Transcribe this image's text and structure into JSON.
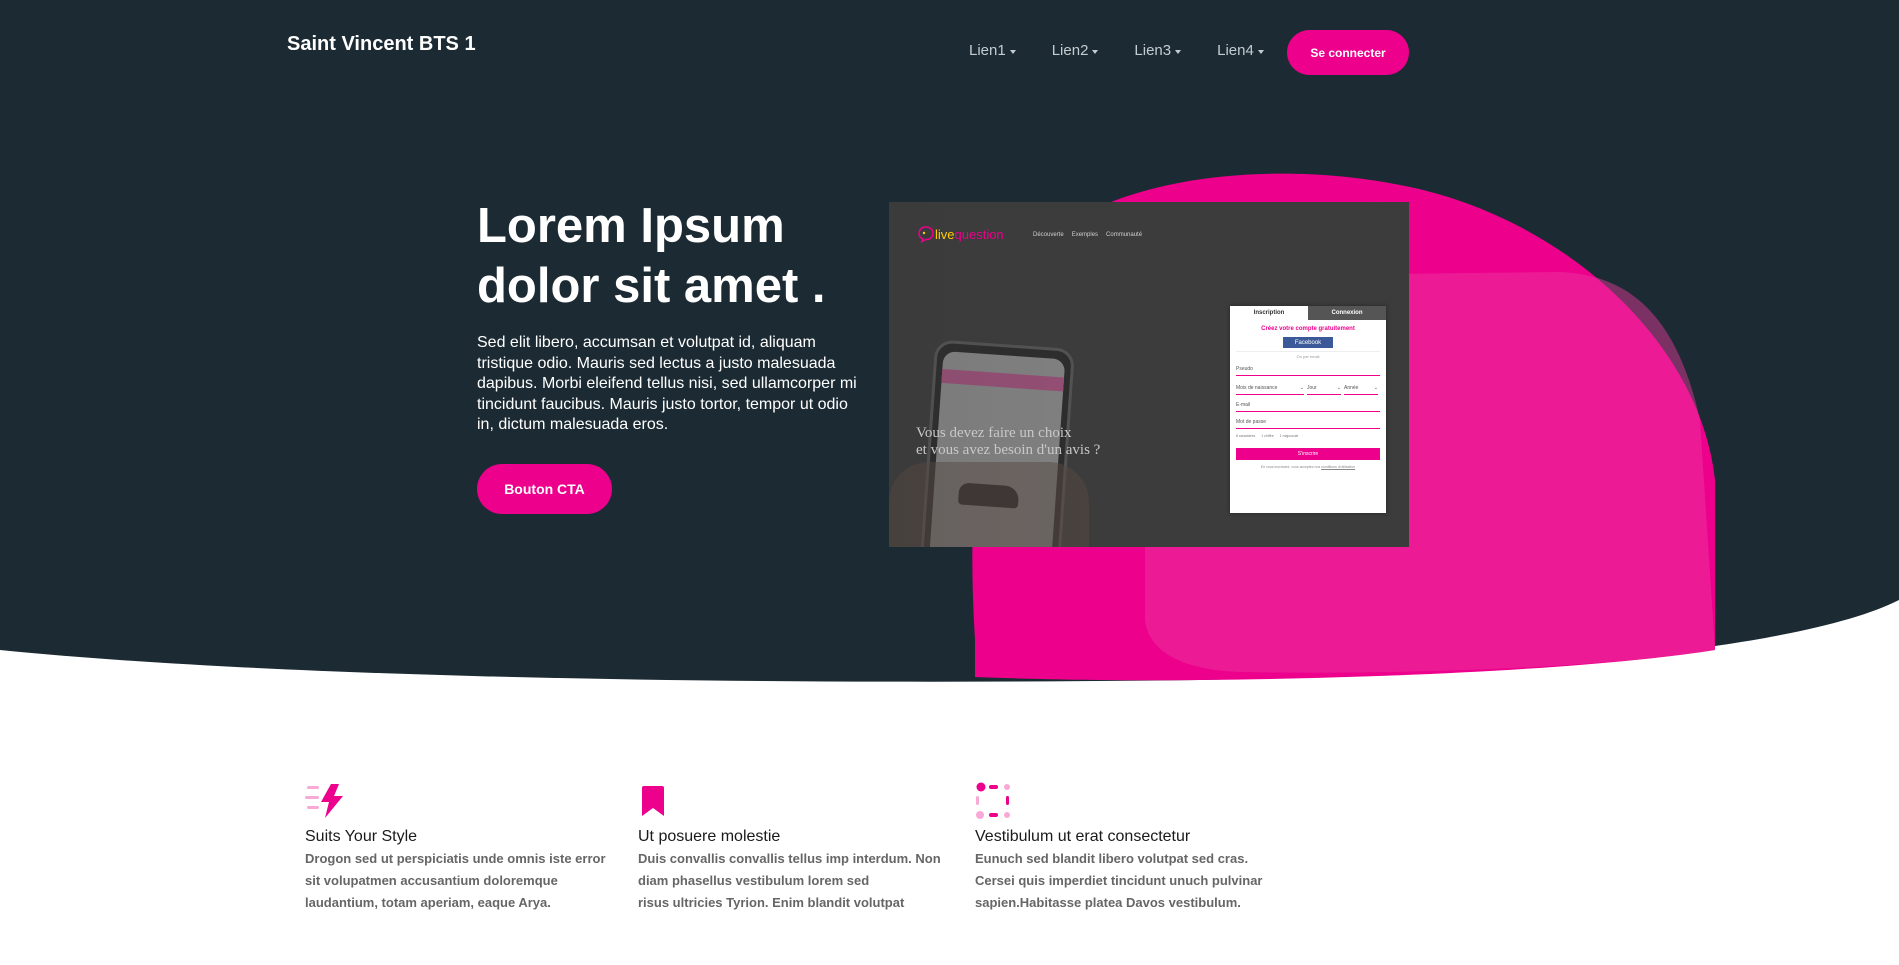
{
  "header": {
    "brand": "Saint Vincent BTS 1",
    "nav": [
      "Lien1",
      "Lien2",
      "Lien3",
      "Lien4"
    ],
    "login_label": "Se connecter"
  },
  "hero": {
    "title_line1": "Lorem Ipsum",
    "title_line2": "dolor sit amet .",
    "text": "Sed elit libero, accumsan et volutpat id, aliquam tristique odio. Mauris sed lectus a justo malesuada dapibus. Morbi eleifend tellus nisi, sed ullamcorper mi tincidunt faucibus. Mauris justo tortor, tempor ut odio in, dictum malesuada eros.",
    "cta_label": "Bouton CTA"
  },
  "screenshot": {
    "logo_live": "live",
    "logo_question": "question",
    "nav": [
      "Découverte",
      "Exemples",
      "Communauté"
    ],
    "phone_app_name": "livequestion",
    "tagline_line1": "Vous devez faire un choix",
    "tagline_line2": "et vous avez besoin d'un avis ?",
    "form": {
      "tab_signup": "Inscription",
      "tab_login": "Connexion",
      "title": "Créez votre compte gratuitement",
      "facebook": "Facebook",
      "or": "Ou par email",
      "pseudo": "Pseudo",
      "birth_month": "Mois de naissance",
      "day": "Jour",
      "year": "Année",
      "email": "E-mail",
      "password": "Mot de passe",
      "hints": [
        "8 caractères",
        "1 chiffre",
        "1 majuscule"
      ],
      "submit": "S'inscrire",
      "terms_text": "En vous inscrivant, vous acceptez nos ",
      "terms_link": "conditions d'utilisation"
    }
  },
  "features": [
    {
      "title": "Suits Your Style",
      "lines": [
        "Drogon sed ut perspiciatis unde omnis iste error",
        "sit volupatmen accusantium doloremque",
        "laudantium, totam aperiam, eaque Arya."
      ],
      "icon": "lightning-icon"
    },
    {
      "title": "Ut posuere molestie",
      "lines": [
        "Duis convallis convallis tellus imp interdum. Non",
        "diam phasellus vestibulum lorem sed",
        "risus ultricies Tyrion. Enim blandit volutpat"
      ],
      "icon": "bookmark-icon"
    },
    {
      "title": "Vestibulum ut erat consectetur",
      "lines": [
        "Eunuch sed blandit libero volutpat sed cras.",
        "Cersei quis imperdiet tincidunt unuch pulvinar",
        "sapien.Habitasse platea Davos vestibulum."
      ],
      "icon": "dots-frame-icon"
    }
  ],
  "colors": {
    "hero_bg": "#1c2b33",
    "accent": "#ec008c",
    "accent_light": "#f9a9d6",
    "text_muted": "#666666"
  }
}
